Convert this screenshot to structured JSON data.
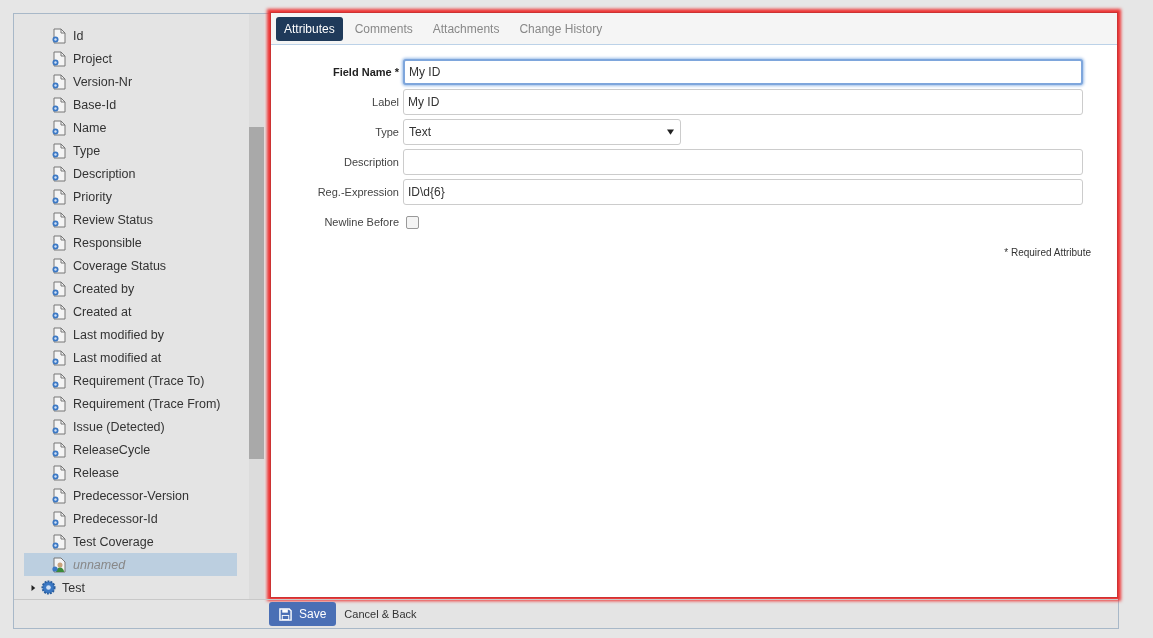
{
  "tree": {
    "items": [
      {
        "label": "Id",
        "selected": false
      },
      {
        "label": "Project",
        "selected": false
      },
      {
        "label": "Version-Nr",
        "selected": false
      },
      {
        "label": "Base-Id",
        "selected": false
      },
      {
        "label": "Name",
        "selected": false
      },
      {
        "label": "Type",
        "selected": false
      },
      {
        "label": "Description",
        "selected": false
      },
      {
        "label": "Priority",
        "selected": false
      },
      {
        "label": "Review Status",
        "selected": false
      },
      {
        "label": "Responsible",
        "selected": false
      },
      {
        "label": "Coverage Status",
        "selected": false
      },
      {
        "label": "Created by",
        "selected": false
      },
      {
        "label": "Created at",
        "selected": false
      },
      {
        "label": "Last modified by",
        "selected": false
      },
      {
        "label": "Last modified at",
        "selected": false
      },
      {
        "label": "Requirement (Trace To)",
        "selected": false
      },
      {
        "label": "Requirement (Trace From)",
        "selected": false
      },
      {
        "label": "Issue (Detected)",
        "selected": false
      },
      {
        "label": "ReleaseCycle",
        "selected": false
      },
      {
        "label": "Release",
        "selected": false
      },
      {
        "label": "Predecessor-Version",
        "selected": false
      },
      {
        "label": "Predecessor-Id",
        "selected": false
      },
      {
        "label": "Test Coverage",
        "selected": false
      },
      {
        "label": "unnamed",
        "selected": true
      }
    ],
    "sibling": {
      "label": "Test",
      "expanded": false
    }
  },
  "tabs": [
    {
      "label": "Attributes",
      "selected": true
    },
    {
      "label": "Comments",
      "selected": false
    },
    {
      "label": "Attachments",
      "selected": false
    },
    {
      "label": "Change History",
      "selected": false
    }
  ],
  "form": {
    "fields": [
      {
        "kind": "text",
        "label": "Field Name *",
        "required": true,
        "focused": true,
        "value": "My ID"
      },
      {
        "kind": "text",
        "label": "Label",
        "required": false,
        "focused": false,
        "value": "My ID"
      },
      {
        "kind": "select",
        "label": "Type",
        "required": false,
        "focused": false,
        "value": "Text"
      },
      {
        "kind": "text",
        "label": "Description",
        "required": false,
        "focused": false
      },
      {
        "kind": "text",
        "label": "Reg.-Expression",
        "required": false,
        "focused": false,
        "value": "ID\\d{6}"
      },
      {
        "kind": "checkbox",
        "label": "Newline Before",
        "required": false,
        "checked": false
      }
    ],
    "note": "* Required Attribute"
  },
  "actions": {
    "save": "Save",
    "cancel": "Cancel & Back"
  }
}
